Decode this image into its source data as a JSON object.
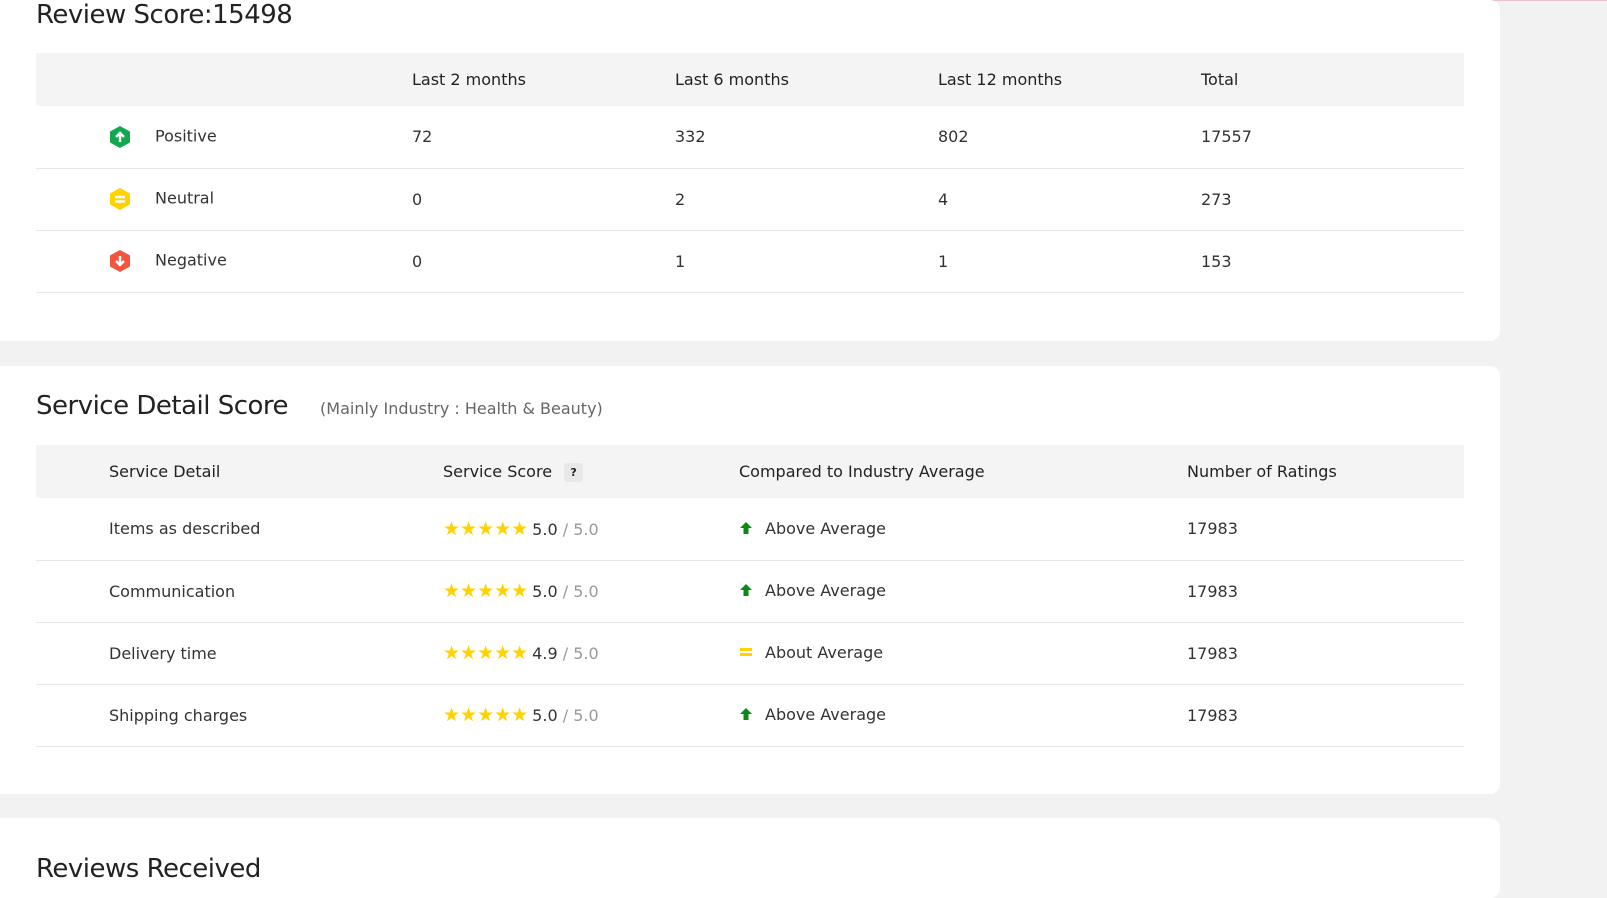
{
  "review_score": {
    "title": "Review Score:15498",
    "columns": [
      "",
      "Last 2 months",
      "Last 6 months",
      "Last 12 months",
      "Total"
    ],
    "rows": [
      {
        "label": "Positive",
        "icon": "positive-up-icon",
        "color": "#13a84f",
        "values": [
          "72",
          "332",
          "802",
          "17557"
        ]
      },
      {
        "label": "Neutral",
        "icon": "neutral-equal-icon",
        "color": "#ffd200",
        "values": [
          "0",
          "2",
          "4",
          "273"
        ]
      },
      {
        "label": "Negative",
        "icon": "negative-down-icon",
        "color": "#f1543f",
        "values": [
          "0",
          "1",
          "1",
          "153"
        ]
      }
    ]
  },
  "service": {
    "title": "Service Detail Score",
    "subtitle": "(Mainly Industry : Health & Beauty)",
    "columns": [
      "Service Detail",
      "Service Score",
      "Compared to Industry Average",
      "Number of Ratings"
    ],
    "help": "?",
    "rows": [
      {
        "label": "Items as described",
        "score": "5.0",
        "max": "/ 5.0",
        "stars": 5,
        "compare": "Above Average",
        "trend": "up",
        "ratings": "17983"
      },
      {
        "label": "Communication",
        "score": "5.0",
        "max": "/ 5.0",
        "stars": 5,
        "compare": "Above Average",
        "trend": "up",
        "ratings": "17983"
      },
      {
        "label": "Delivery time",
        "score": "4.9",
        "max": "/ 5.0",
        "stars": 5,
        "compare": "About Average",
        "trend": "equal",
        "ratings": "17983"
      },
      {
        "label": "Shipping charges",
        "score": "5.0",
        "max": "/ 5.0",
        "stars": 5,
        "compare": "Above Average",
        "trend": "up",
        "ratings": "17983"
      }
    ]
  },
  "reviews": {
    "title": "Reviews Received"
  }
}
